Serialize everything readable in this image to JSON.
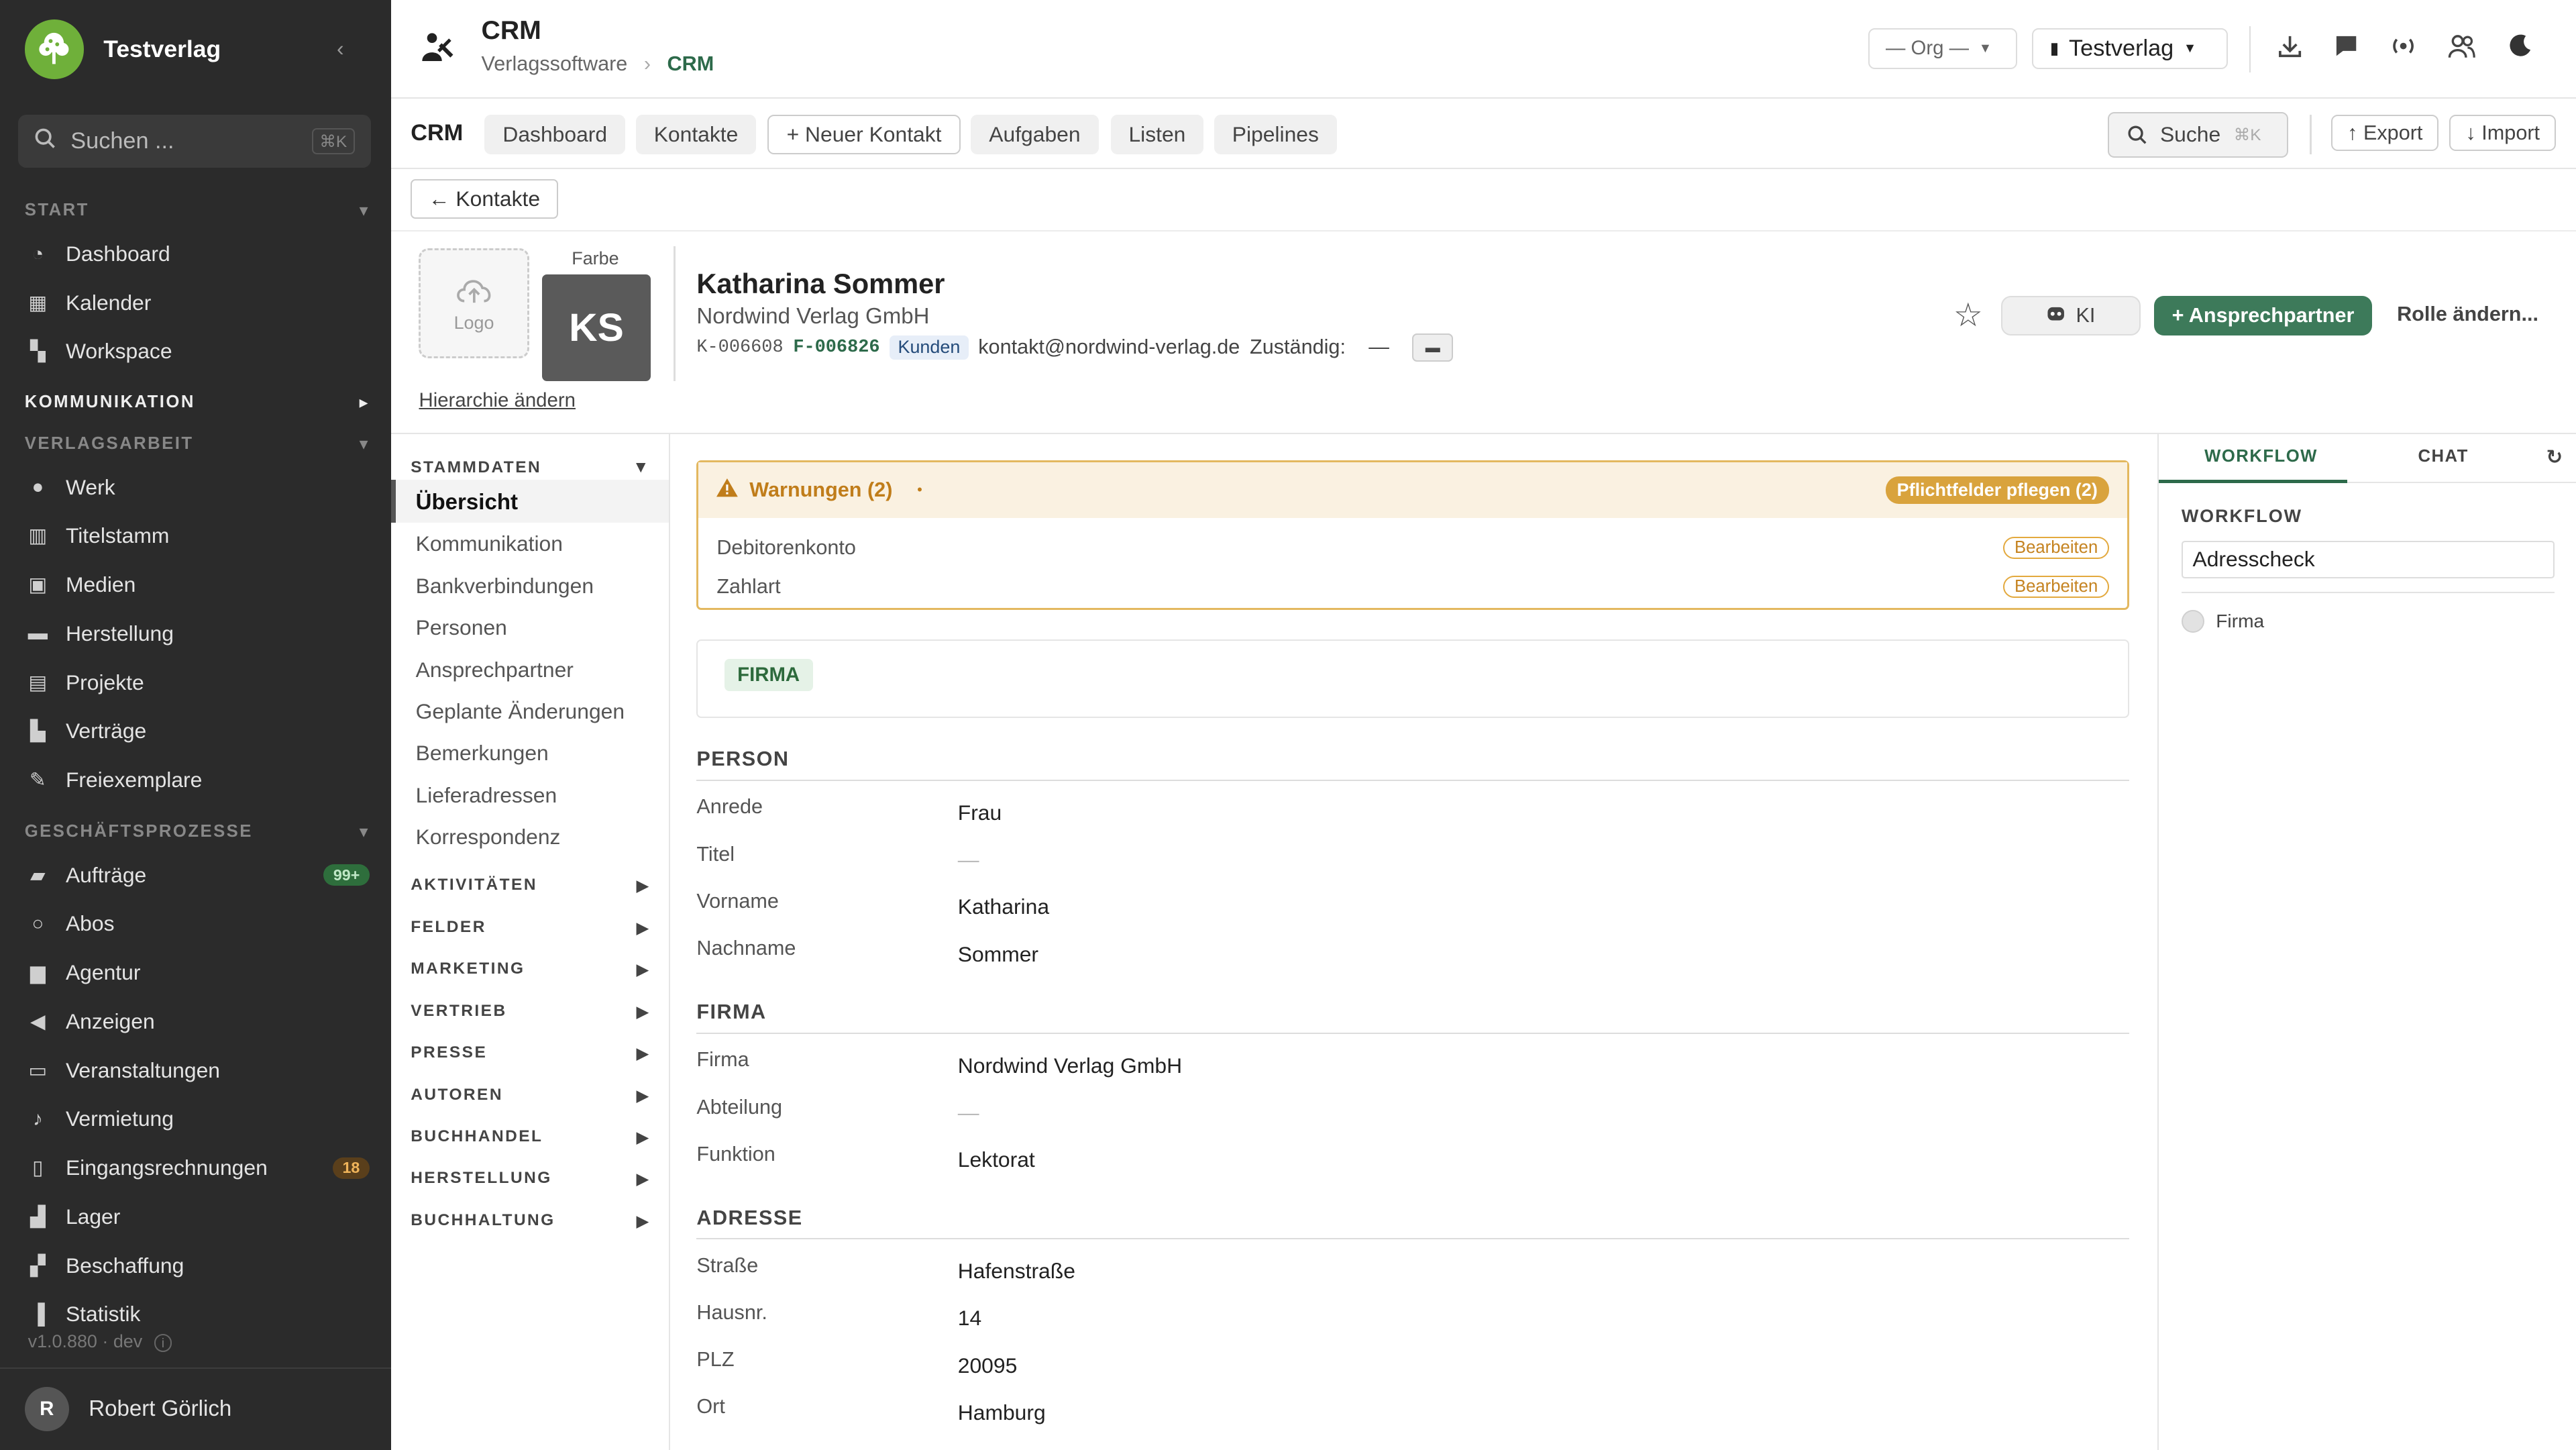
{
  "sidebar": {
    "brand": "Testverlag",
    "search_placeholder": "Suchen ...",
    "search_shortcut": "⌘K",
    "sections": {
      "start": "START",
      "kommunikation": "KOMMUNIKATION",
      "verlagsarbeit": "VERLAGSARBEIT",
      "geschaeftsprozesse": "GESCHÄFTSPROZESSE"
    },
    "start_items": [
      {
        "label": "Dashboard",
        "icon": "dashboard-icon"
      },
      {
        "label": "Kalender",
        "icon": "calendar-icon"
      },
      {
        "label": "Workspace",
        "icon": "workspace-icon"
      }
    ],
    "verlag_items": [
      {
        "label": "Werk",
        "icon": "bulb-icon"
      },
      {
        "label": "Titelstamm",
        "icon": "books-icon"
      },
      {
        "label": "Medien",
        "icon": "image-icon"
      },
      {
        "label": "Herstellung",
        "icon": "briefcase-icon"
      },
      {
        "label": "Projekte",
        "icon": "project-icon"
      },
      {
        "label": "Verträge",
        "icon": "contract-icon"
      },
      {
        "label": "Freiexemplare",
        "icon": "feather-icon"
      }
    ],
    "geschaeft_items": [
      {
        "label": "Aufträge",
        "icon": "wallet-icon",
        "badge": "99+"
      },
      {
        "label": "Abos",
        "icon": "circle-icon"
      },
      {
        "label": "Agentur",
        "icon": "bag-icon"
      },
      {
        "label": "Anzeigen",
        "icon": "megaphone-icon"
      },
      {
        "label": "Veranstaltungen",
        "icon": "ticket-icon"
      },
      {
        "label": "Vermietung",
        "icon": "music-icon"
      },
      {
        "label": "Eingangsrechnungen",
        "icon": "invoice-icon",
        "badge": "18"
      },
      {
        "label": "Lager",
        "icon": "forklift-icon"
      },
      {
        "label": "Beschaffung",
        "icon": "truck-icon"
      },
      {
        "label": "Statistik",
        "icon": "chart-icon"
      }
    ],
    "version": "v1.0.880 · dev",
    "user_initial": "R",
    "user_name": "Robert Görlich"
  },
  "topbar": {
    "title": "CRM",
    "crumb_root": "Verlagssoftware",
    "crumb_sep": "›",
    "crumb_current": "CRM",
    "org_select": "— Org —",
    "tenant_select": "Testverlag"
  },
  "navbar": {
    "label": "CRM",
    "tabs": [
      "Dashboard",
      "Kontakte",
      "+ Neuer Kontakt",
      "Aufgaben",
      "Listen",
      "Pipelines"
    ],
    "search": "Suche",
    "search_shortcut": "⌘K",
    "export": "↑ Export",
    "import": "↓ Import"
  },
  "back_label": "← Kontakte",
  "contact": {
    "logo_label": "Logo",
    "farbe_label": "Farbe",
    "initials": "KS",
    "hierarchy_link": "Hierarchie ändern",
    "name": "Katharina Sommer",
    "company": "Nordwind Verlag GmbH",
    "k_number": "K-006608",
    "f_number": "F-006826",
    "tag": "Kunden",
    "email": "kontakt@nordwind-verlag.de",
    "zustaendig_label": "Zuständig:",
    "zustaendig_value": "—",
    "ki_label": "KI",
    "add_button": "+ Ansprechpartner",
    "role_button": "Rolle ändern..."
  },
  "leftnav": {
    "stammdaten": "STAMMDATEN",
    "items": [
      "Übersicht",
      "Kommunikation",
      "Bankverbindungen",
      "Personen",
      "Ansprechpartner",
      "Geplante Änderungen",
      "Bemerkungen",
      "Lieferadressen",
      "Korrespondenz"
    ],
    "sections": [
      "AKTIVITÄTEN",
      "FELDER",
      "MARKETING",
      "VERTRIEB",
      "PRESSE",
      "AUTOREN",
      "BUCHHANDEL",
      "HERSTELLUNG",
      "BUCHHALTUNG"
    ]
  },
  "warnings": {
    "title": "Warnungen (2)",
    "marker": "•",
    "action": "Pflichtfelder pflegen (2)",
    "rows": [
      {
        "label": "Debitorenkonto",
        "action": "Bearbeiten"
      },
      {
        "label": "Zahlart",
        "action": "Bearbeiten"
      }
    ]
  },
  "firma_tag": "FIRMA",
  "sections": {
    "person": {
      "title": "PERSON",
      "fields": [
        {
          "label": "Anrede",
          "value": "Frau"
        },
        {
          "label": "Titel",
          "value": "—"
        },
        {
          "label": "Vorname",
          "value": "Katharina"
        },
        {
          "label": "Nachname",
          "value": "Sommer"
        }
      ]
    },
    "firma": {
      "title": "FIRMA",
      "fields": [
        {
          "label": "Firma",
          "value": "Nordwind Verlag GmbH"
        },
        {
          "label": "Abteilung",
          "value": "—"
        },
        {
          "label": "Funktion",
          "value": "Lektorat"
        }
      ]
    },
    "adresse": {
      "title": "ADRESSE",
      "fields": [
        {
          "label": "Straße",
          "value": "Hafenstraße"
        },
        {
          "label": "Hausnr.",
          "value": "14"
        },
        {
          "label": "PLZ",
          "value": "20095"
        },
        {
          "label": "Ort",
          "value": "Hamburg"
        }
      ]
    }
  },
  "rightpanel": {
    "tab_workflow": "WORKFLOW",
    "tab_chat": "CHAT",
    "workflow_label": "WORKFLOW",
    "workflow_value": "Adresscheck",
    "step": "Firma"
  }
}
